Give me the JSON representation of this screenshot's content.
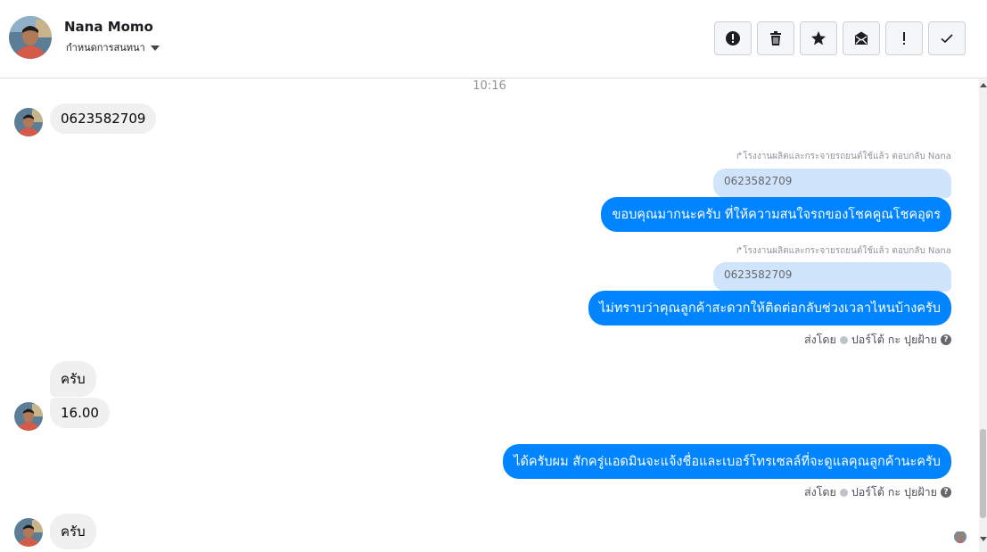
{
  "header": {
    "contact_name": "Nana Momo",
    "assign_label": "กำหนดการสนทนา",
    "actions": [
      {
        "name": "spam",
        "icon": "alert-circle-icon"
      },
      {
        "name": "delete",
        "icon": "trash-icon"
      },
      {
        "name": "star",
        "icon": "star-icon"
      },
      {
        "name": "mark-unread",
        "icon": "envelope-icon"
      },
      {
        "name": "important",
        "icon": "exclamation-icon"
      },
      {
        "name": "done",
        "icon": "check-icon"
      }
    ]
  },
  "thread": {
    "timestamp": "10:16",
    "messages": [
      {
        "direction": "in",
        "text": "0623582709"
      },
      {
        "direction": "out",
        "reply_context": "โรงงานผลิตและกระจายรถยนต์ใช้แล้ว ตอบกลับ Nana",
        "quoted": "0623582709",
        "text": "ขอบคุณมากนะครับ ที่ให้ความสนใจรถของโชคคูณโชคอุดร"
      },
      {
        "direction": "out",
        "reply_context": "โรงงานผลิตและกระจายรถยนต์ใช้แล้ว ตอบกลับ Nana",
        "quoted": "0623582709",
        "text": "ไม่ทราบว่าคุณลูกค้าสะดวกให้ติดต่อกลับช่วงเวลาไหนบ้างครับ"
      },
      {
        "direction": "in",
        "text": "ครับ"
      },
      {
        "direction": "in",
        "text": "16.00"
      },
      {
        "direction": "out",
        "text": "ได้ครับผม สักครู่แอดมินจะแจ้งชื่อและเบอร์โทรเซลล์ที่จะดูแลคุณลูกค้านะครับ"
      },
      {
        "direction": "in",
        "text": "ครับ"
      }
    ],
    "sent_by_prefix": "ส่งโดย",
    "sent_by_name": "ปอร์โต้ กะ ปุยฝ้าย",
    "help_glyph": "?"
  },
  "colors": {
    "outgoing": "#0084ff",
    "incoming": "#f0f0f0",
    "quote": "#d0e4fb"
  }
}
